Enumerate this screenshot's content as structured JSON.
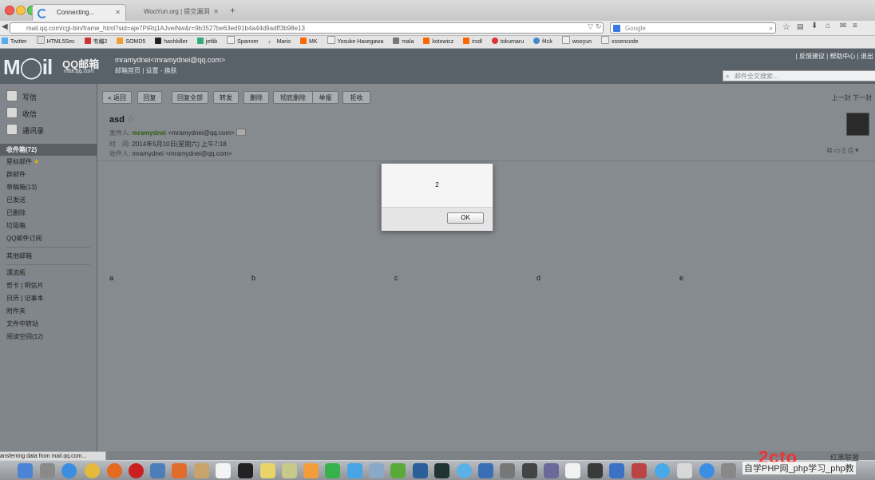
{
  "browser": {
    "tabs": [
      {
        "label": "Connecting...",
        "active": true
      },
      {
        "label": "WooYun.org | 提交漏洞",
        "active": false
      }
    ],
    "new_tab": "+",
    "url": "mail.qq.com/cgi-bin/frame_html?sid=aje7PiRq1AJveiNw&r=9b3527be63ed91b4a44d9adff3b98e13",
    "url_domain": "mail.qq.com",
    "search_placeholder": "Google",
    "bookmarks": [
      "Twitter",
      "HTML5Sec",
      "韦编2",
      "SOMD5",
      "hashkiller",
      "jetlib",
      "Spanner",
      "Mario",
      "MK",
      "Yosuke Hasegawa",
      "mala",
      "kotowicz",
      "irsdl",
      "tokumaru",
      "f4ck",
      "wooyun",
      "xssencode"
    ],
    "status_text": "ansferring data from mail.qq.com..."
  },
  "header": {
    "logo": "M◯il",
    "logo_cn": "QQ邮箱",
    "logo_domain": "mail.qq.com",
    "user": "mramydnei<mramydnei@qq.com>",
    "links": "邮箱首页 | 设置 - 换肤",
    "top_links": "| 反馈建议 | 帮助中心 | 退出",
    "search_placeholder": "邮件全文搜索..."
  },
  "sidebar": {
    "compose": "写信",
    "receive": "收信",
    "contacts": "通讯录",
    "inbox": "收件箱(72)",
    "items": [
      "星标邮件",
      "群邮件",
      "草稿箱(13)",
      "已发送",
      "已删除",
      "垃圾箱",
      "QQ邮件订阅"
    ],
    "other": "其他邮箱",
    "items2": [
      "漂流瓶",
      "贺卡 | 明信片",
      "日历 | 记事本",
      "附件夹",
      "文件中转站",
      "阅读空间(12)"
    ]
  },
  "toolbar": {
    "buttons": [
      "« 返回",
      "回复",
      "回复全部",
      "转发",
      "删除",
      "彻底删除",
      "举报",
      "拒收"
    ],
    "pager": "上一封  下一封"
  },
  "email": {
    "subject": "asd",
    "from_label": "发件人:",
    "from_name": "mramydnei",
    "from_addr": "<mramydnei@qq.com>",
    "time_label": "时　间:",
    "time": "2014年5月10日(星期六) 上午7:18",
    "to_label": "收件人:",
    "to": "mramydnei <mramydnei@qq.com>",
    "columns": [
      "a",
      "b",
      "c",
      "d",
      "e"
    ]
  },
  "dialog": {
    "message": "2",
    "ok_label": "OK"
  },
  "watermark": {
    "brand": "2cto",
    "line": "自学PHP网_php学习_php教",
    "sub": "红黑联盟"
  }
}
